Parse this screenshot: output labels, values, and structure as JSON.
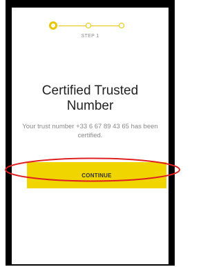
{
  "stepper": {
    "current_step_label": "STEP 1",
    "steps_total": 3,
    "active_step": 1,
    "accent_color": "#e8c600"
  },
  "content": {
    "title": "Certified Trusted Number",
    "message": "Your trust number +33 6 67 89 43 65 has been certified."
  },
  "actions": {
    "continue_label": "CONTINUE",
    "button_color": "#f0d500"
  },
  "annotation": {
    "highlight_color": "#e02020"
  }
}
